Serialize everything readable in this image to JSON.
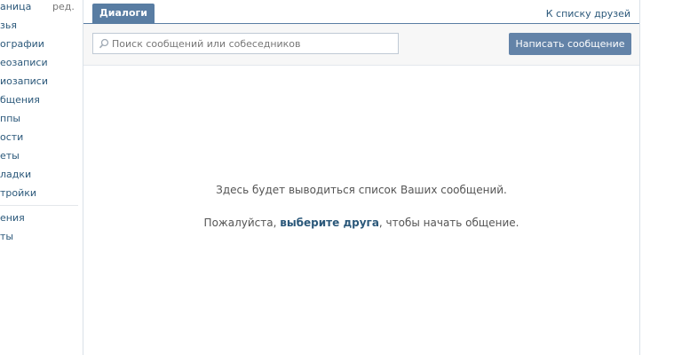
{
  "left_nav": {
    "edit_label": "ред.",
    "items": [
      "аница",
      "зья",
      "ографии",
      "еозаписи",
      "иозаписи",
      "бщения",
      "ппы",
      "ости",
      "еты",
      "ладки",
      "тройки"
    ],
    "bottom_items": [
      "ения",
      "ты"
    ]
  },
  "tabs": {
    "active": "Диалоги",
    "friends_link": "К списку друзей"
  },
  "toolbar": {
    "search_placeholder": "Поиск сообщений или собеседников",
    "write_button": "Написать сообщение"
  },
  "empty_state": {
    "line1": "Здесь будет выводиться список Ваших сообщений.",
    "line2_prefix": "Пожалуйста, ",
    "line2_link": "выберите друга",
    "line2_suffix": ", чтобы начать общение."
  },
  "colors": {
    "accent": "#597da3",
    "link": "#2b587a",
    "button": "#6383a8"
  }
}
